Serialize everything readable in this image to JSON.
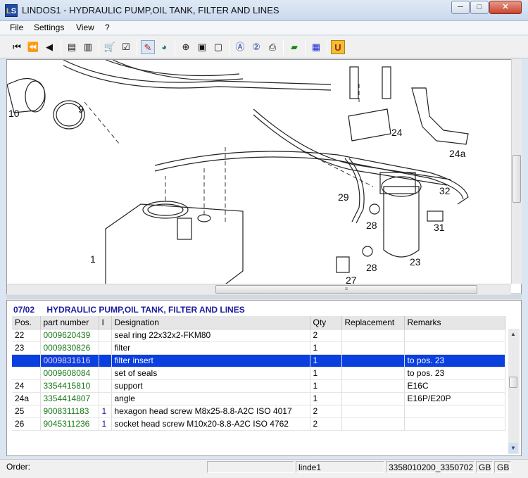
{
  "window": {
    "icon_text": "LS",
    "title": "LINDOS1 - HYDRAULIC PUMP,OIL TANK,  FILTER AND LINES",
    "minimize": "─",
    "maximize": "□",
    "close": "✕"
  },
  "menu": {
    "file": "File",
    "settings": "Settings",
    "view": "View",
    "help": "?"
  },
  "toolbar": {
    "buttons": [
      {
        "icon": "first-icon",
        "glyph": "⏮"
      },
      {
        "icon": "fast-back-icon",
        "glyph": "⏪"
      },
      {
        "icon": "back-icon",
        "glyph": "◀"
      },
      {
        "icon": "prev-page-icon",
        "glyph": "▤"
      },
      {
        "icon": "next-page-icon",
        "glyph": "▥"
      },
      {
        "icon": "cart-icon",
        "glyph": "🛒"
      },
      {
        "icon": "checklist-icon",
        "glyph": "☑"
      },
      {
        "icon": "pointer-pen-icon",
        "glyph": "✎"
      },
      {
        "icon": "globe-icon",
        "glyph": "◕"
      },
      {
        "icon": "zoom-icon",
        "glyph": "⊕"
      },
      {
        "icon": "page-fit-icon",
        "glyph": "▣"
      },
      {
        "icon": "page-icon",
        "glyph": "▢"
      },
      {
        "icon": "search-a-icon",
        "glyph": "Ⓐ"
      },
      {
        "icon": "search-2-icon",
        "glyph": "②"
      },
      {
        "icon": "print-icon",
        "glyph": "⎙"
      },
      {
        "icon": "book-icon",
        "glyph": "▰"
      },
      {
        "icon": "grid-icon",
        "glyph": "▦"
      },
      {
        "icon": "u-icon",
        "glyph": "U"
      }
    ]
  },
  "drawing": {
    "callouts": [
      "10",
      "9",
      "24",
      "24a",
      "29",
      "32",
      "28",
      "31",
      "1",
      "28",
      "23",
      "27"
    ]
  },
  "parts": {
    "section_code": "07/02",
    "section_title": "HYDRAULIC PUMP,OIL TANK,  FILTER AND LINES",
    "columns": {
      "pos": "Pos.",
      "part_number": "part number",
      "indicator": "I",
      "designation": "Designation",
      "qty": "Qty",
      "replacement": "Replacement",
      "remarks": "Remarks"
    },
    "rows": [
      {
        "pos": "22",
        "part_number": "0009620439",
        "indicator": "",
        "designation": "seal ring 22x32x2-FKM80",
        "qty": "2",
        "replacement": "",
        "remarks": ""
      },
      {
        "pos": "23",
        "part_number": "0009830826",
        "indicator": "",
        "designation": "filter",
        "qty": "1",
        "replacement": "",
        "remarks": ""
      },
      {
        "pos": "",
        "part_number": "0009831616",
        "indicator": "",
        "designation": "filter insert",
        "qty": "1",
        "replacement": "",
        "remarks": "to pos. 23"
      },
      {
        "pos": "",
        "part_number": "0009608084",
        "indicator": "",
        "designation": "set of seals",
        "qty": "1",
        "replacement": "",
        "remarks": "to pos. 23"
      },
      {
        "pos": "24",
        "part_number": "3354415810",
        "indicator": "",
        "designation": "support",
        "qty": "1",
        "replacement": "",
        "remarks": "E16C"
      },
      {
        "pos": "24a",
        "part_number": "3354414807",
        "indicator": "",
        "designation": "angle",
        "qty": "1",
        "replacement": "",
        "remarks": "E16P/E20P"
      },
      {
        "pos": "25",
        "part_number": "9008311183",
        "indicator": "1",
        "designation": "hexagon head screw M8x25-8.8-A2C  ISO 4017",
        "qty": "2",
        "replacement": "",
        "remarks": ""
      },
      {
        "pos": "26",
        "part_number": "9045311236",
        "indicator": "1",
        "designation": "socket head screw M10x20-8.8-A2C  ISO 4762",
        "qty": "2",
        "replacement": "",
        "remarks": ""
      }
    ],
    "selected_row": 2
  },
  "status": {
    "order_label": "Order:",
    "order_value": "",
    "user": "linde1",
    "ids": "3358010200_3350702",
    "lang1": "GB",
    "lang2": "GB"
  },
  "colors": {
    "selection": "#0a3fe0",
    "part_number": "#1a7a1a",
    "header": "#1a1aa0"
  }
}
